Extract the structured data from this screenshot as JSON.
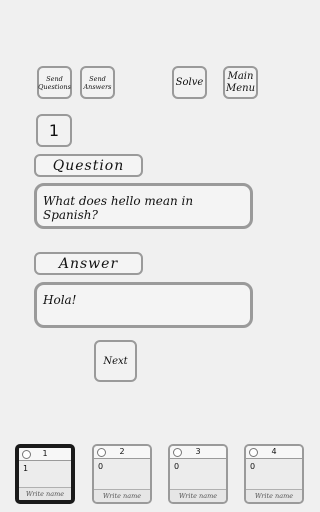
{
  "toolbar": {
    "send_questions": "Send Questions",
    "send_answers": "Send Answers",
    "solve": "Solve",
    "main_menu": "Main Menu"
  },
  "question_number": "1",
  "question": {
    "label": "Question",
    "text": "What does hello mean in Spanish?"
  },
  "answer": {
    "label": "Answer",
    "text": "Hola!"
  },
  "next_label": "Next",
  "slots": [
    {
      "number": "1",
      "count": "1",
      "name_placeholder": "Write name"
    },
    {
      "number": "2",
      "count": "0",
      "name_placeholder": "Write name"
    },
    {
      "number": "3",
      "count": "0",
      "name_placeholder": "Write name"
    },
    {
      "number": "4",
      "count": "0",
      "name_placeholder": "Write name"
    }
  ]
}
